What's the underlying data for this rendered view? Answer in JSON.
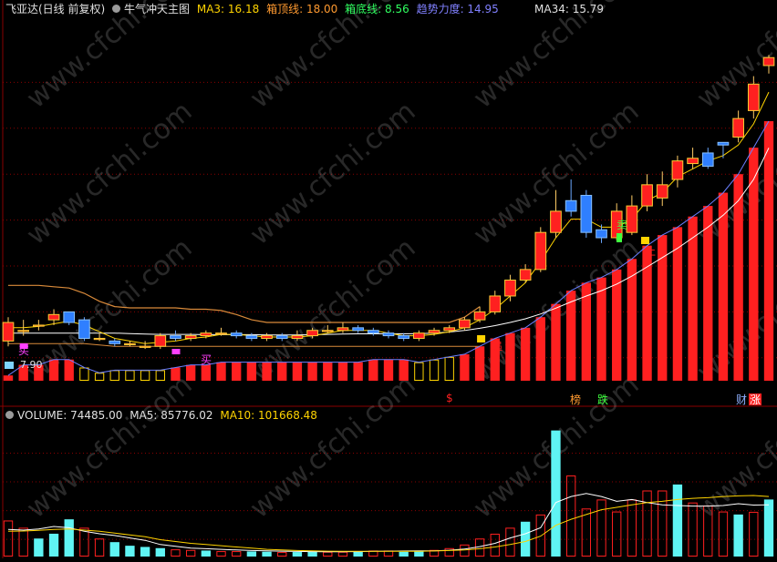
{
  "header": {
    "stock_name": "飞亚达(日线 前复权)",
    "indicator_name": "牛气冲天主图",
    "ma3_label": "MA3: 16.18",
    "box_top_label": "箱顶线: 18.00",
    "box_bottom_label": "箱底线: 8.56",
    "trend_label": "趋势力度: 14.95",
    "ma34_label": "MA34: 15.79"
  },
  "volume_header": {
    "title": "VOLUME: 74485.00",
    "ma5_label": "MA5: 85776.02",
    "ma10_label": "MA10: 101668.48"
  },
  "price_axis_label": "7.90",
  "watermark": "www.cfchi.com",
  "signals": {
    "buy": "买",
    "chase": "追",
    "sell": "卖",
    "stop": "止",
    "dollar": "$",
    "bang": "榜",
    "die": "跌",
    "cai": "财",
    "zhang": "涨"
  },
  "colors": {
    "up": "#ff2020",
    "down": "#2f7fff",
    "ma_yellow": "#ffd400",
    "ma_white": "#ffffff",
    "band": "#d98a3a",
    "cyan": "#5ff4f4",
    "grid": "#8a0000",
    "magenta": "#ff40ff"
  },
  "chart_data": {
    "type": "candlestick",
    "x": [
      1,
      2,
      3,
      4,
      5,
      6,
      7,
      8,
      9,
      10,
      11,
      12,
      13,
      14,
      15,
      16,
      17,
      18,
      19,
      20,
      21,
      22,
      23,
      24,
      25,
      26,
      27,
      28,
      29,
      30,
      31,
      32,
      33,
      34,
      35,
      36,
      37,
      38,
      39,
      40,
      41,
      42,
      43,
      44,
      45,
      46,
      47,
      48,
      49,
      50,
      51
    ],
    "open": [
      8.5,
      8.9,
      9.1,
      9.3,
      9.6,
      9.3,
      8.6,
      8.5,
      8.4,
      8.3,
      8.3,
      8.7,
      8.6,
      8.7,
      8.8,
      8.8,
      8.7,
      8.6,
      8.7,
      8.6,
      8.7,
      8.9,
      8.9,
      9.0,
      8.9,
      8.8,
      8.7,
      8.6,
      8.8,
      8.9,
      9.0,
      9.3,
      9.6,
      10.2,
      10.8,
      11.2,
      12.6,
      13.8,
      14.0,
      12.7,
      12.4,
      12.6,
      13.6,
      13.9,
      14.6,
      15.2,
      15.6,
      16.0,
      16.2,
      17.2,
      18.9
    ],
    "close": [
      9.2,
      8.9,
      9.1,
      9.5,
      9.2,
      8.6,
      8.6,
      8.4,
      8.4,
      8.3,
      8.7,
      8.6,
      8.7,
      8.8,
      8.8,
      8.7,
      8.6,
      8.7,
      8.6,
      8.7,
      8.9,
      8.9,
      9.0,
      8.9,
      8.8,
      8.7,
      8.6,
      8.8,
      8.9,
      9.0,
      9.3,
      9.6,
      10.2,
      10.8,
      11.2,
      12.6,
      13.4,
      13.4,
      12.6,
      12.4,
      13.4,
      13.6,
      14.4,
      14.4,
      15.3,
      15.4,
      15.1,
      15.9,
      16.9,
      18.2,
      19.2
    ],
    "high": [
      9.4,
      9.3,
      9.3,
      9.7,
      9.6,
      9.4,
      8.8,
      8.6,
      8.5,
      8.5,
      8.8,
      8.9,
      8.8,
      8.9,
      9.0,
      8.9,
      8.8,
      8.8,
      8.8,
      8.9,
      9.0,
      9.1,
      9.2,
      9.1,
      9.0,
      8.9,
      8.8,
      8.9,
      9.0,
      9.1,
      9.4,
      9.8,
      10.4,
      11.0,
      11.4,
      12.8,
      14.2,
      14.6,
      14.2,
      12.9,
      13.7,
      14.0,
      14.8,
      14.9,
      15.5,
      15.8,
      15.8,
      16.0,
      17.2,
      18.5,
      19.3
    ],
    "low": [
      8.3,
      8.7,
      8.9,
      9.1,
      9.1,
      8.5,
      8.5,
      8.3,
      8.3,
      8.2,
      8.2,
      8.5,
      8.5,
      8.6,
      8.7,
      8.6,
      8.5,
      8.5,
      8.5,
      8.5,
      8.6,
      8.8,
      8.8,
      8.8,
      8.7,
      8.6,
      8.5,
      8.5,
      8.7,
      8.8,
      8.9,
      9.2,
      9.5,
      10.0,
      10.7,
      11.1,
      12.4,
      13.2,
      12.4,
      12.2,
      12.3,
      12.5,
      13.4,
      13.6,
      14.3,
      15.0,
      15.0,
      15.4,
      16.0,
      16.9,
      18.6
    ],
    "ma3": [
      9.0,
      9.0,
      9.05,
      9.15,
      9.25,
      9.1,
      8.85,
      8.6,
      8.5,
      8.4,
      8.45,
      8.5,
      8.6,
      8.65,
      8.75,
      8.75,
      8.7,
      8.65,
      8.65,
      8.65,
      8.7,
      8.8,
      8.9,
      8.9,
      8.9,
      8.8,
      8.7,
      8.7,
      8.75,
      8.85,
      9.0,
      9.3,
      9.7,
      10.2,
      10.7,
      11.5,
      12.4,
      13.1,
      13.1,
      12.8,
      12.8,
      13.1,
      13.8,
      14.1,
      14.7,
      15.0,
      15.3,
      15.5,
      15.9,
      16.7,
      17.9
    ],
    "ma34": [
      8.8,
      8.8,
      8.8,
      8.8,
      8.8,
      8.8,
      8.8,
      8.8,
      8.78,
      8.76,
      8.75,
      8.75,
      8.75,
      8.74,
      8.74,
      8.74,
      8.74,
      8.73,
      8.73,
      8.73,
      8.74,
      8.75,
      8.76,
      8.77,
      8.77,
      8.77,
      8.77,
      8.78,
      8.8,
      8.84,
      8.9,
      8.98,
      9.08,
      9.2,
      9.34,
      9.52,
      9.74,
      9.98,
      10.2,
      10.4,
      10.65,
      10.95,
      11.3,
      11.65,
      12.0,
      12.4,
      12.8,
      13.25,
      13.8,
      14.6,
      15.79
    ],
    "box_top": [
      10.6,
      10.6,
      10.6,
      10.55,
      10.5,
      10.3,
      10.0,
      9.8,
      9.75,
      9.75,
      9.75,
      9.75,
      9.7,
      9.7,
      9.65,
      9.5,
      9.3,
      9.2,
      9.2,
      9.2,
      9.2,
      9.2,
      9.2,
      9.2,
      9.2,
      9.2,
      9.2,
      9.2,
      9.2,
      9.2,
      9.4,
      9.8,
      null,
      null,
      null,
      null,
      null,
      null,
      null,
      null,
      null,
      null,
      null,
      null,
      null,
      null,
      null,
      null,
      null,
      null,
      null
    ],
    "box_bottom": [
      8.4,
      8.4,
      8.4,
      8.4,
      8.4,
      8.4,
      8.35,
      8.3,
      8.3,
      8.3,
      8.3,
      8.3,
      8.3,
      8.3,
      8.3,
      8.3,
      8.3,
      8.3,
      8.3,
      8.3,
      8.3,
      8.3,
      8.3,
      8.3,
      8.3,
      8.3,
      8.3,
      8.3,
      8.3,
      8.3,
      8.3,
      8.3,
      null,
      null,
      null,
      null,
      null,
      null,
      null,
      null,
      null,
      null,
      null,
      null,
      null,
      null,
      null,
      null,
      null,
      null,
      null
    ],
    "trend_bars": [
      7.2,
      7.6,
      7.6,
      7.8,
      7.8,
      7.5,
      7.3,
      7.4,
      7.4,
      7.4,
      7.4,
      7.5,
      7.6,
      7.6,
      7.7,
      7.7,
      7.7,
      7.7,
      7.7,
      7.7,
      7.7,
      7.7,
      7.7,
      7.7,
      7.8,
      7.8,
      7.8,
      7.7,
      7.8,
      7.9,
      8.0,
      8.3,
      8.6,
      8.8,
      9.0,
      9.4,
      9.9,
      10.4,
      10.7,
      10.9,
      11.2,
      11.6,
      12.1,
      12.5,
      12.8,
      13.2,
      13.6,
      14.1,
      14.8,
      15.8,
      16.8
    ],
    "trend_colors": [
      "r",
      "r",
      "r",
      "r",
      "r",
      "y",
      "y",
      "y",
      "y",
      "y",
      "y",
      "r",
      "r",
      "r",
      "r",
      "r",
      "r",
      "r",
      "r",
      "r",
      "r",
      "r",
      "r",
      "r",
      "r",
      "r",
      "r",
      "y",
      "y",
      "y",
      "r",
      "r",
      "r",
      "r",
      "r",
      "r",
      "r",
      "r",
      "r",
      "r",
      "r",
      "r",
      "r",
      "r",
      "r",
      "r",
      "r",
      "r",
      "r",
      "r",
      "r"
    ],
    "volume": [
      60000,
      48000,
      30000,
      38000,
      62000,
      48000,
      30000,
      24000,
      18000,
      16000,
      14000,
      12000,
      11000,
      10000,
      9000,
      9000,
      8500,
      8000,
      7500,
      7500,
      8000,
      8000,
      8000,
      9000,
      10000,
      10000,
      8000,
      9000,
      11000,
      14000,
      20000,
      30000,
      38000,
      48000,
      58000,
      70000,
      210000,
      135000,
      80000,
      95000,
      75000,
      95000,
      110000,
      110000,
      120000,
      90000,
      85000,
      75000,
      70000,
      74485,
      95000
    ],
    "vol_colors": [
      "r",
      "r",
      "c",
      "c",
      "c",
      "r",
      "r",
      "c",
      "c",
      "c",
      "c",
      "r",
      "r",
      "c",
      "r",
      "r",
      "c",
      "c",
      "r",
      "c",
      "c",
      "r",
      "r",
      "c",
      "r",
      "r",
      "c",
      "c",
      "r",
      "r",
      "r",
      "r",
      "r",
      "r",
      "c",
      "r",
      "c",
      "r",
      "r",
      "r",
      "r",
      "r",
      "r",
      "r",
      "c",
      "r",
      "r",
      "r",
      "c",
      "r",
      "c"
    ],
    "vol_ma5": [
      45000,
      44000,
      46000,
      50000,
      48000,
      42000,
      38000,
      35000,
      31000,
      27000,
      20000,
      17000,
      14000,
      13000,
      12000,
      11000,
      10000,
      9500,
      9000,
      8500,
      8200,
      8000,
      8000,
      8200,
      8600,
      9000,
      9200,
      9500,
      9500,
      10500,
      12500,
      16500,
      22000,
      31000,
      38000,
      48000,
      90000,
      100000,
      105000,
      100000,
      92000,
      95000,
      90000,
      86000,
      85000,
      84000,
      84000,
      85000,
      88000,
      85776,
      86000
    ],
    "vol_ma10": [
      42000,
      42500,
      43500,
      45000,
      46000,
      44000,
      42000,
      39000,
      36000,
      33000,
      28000,
      25000,
      22000,
      20000,
      18000,
      16000,
      14000,
      12000,
      11000,
      10000,
      9500,
      9000,
      8800,
      8700,
      8700,
      8700,
      8700,
      8800,
      9200,
      10000,
      11000,
      13000,
      16000,
      20000,
      25000,
      34000,
      52000,
      62000,
      70000,
      78000,
      82000,
      86000,
      90000,
      92000,
      95000,
      97000,
      98000,
      100000,
      101000,
      101668,
      100000
    ],
    "price_range": [
      7.0,
      20.0
    ],
    "volume_range": [
      0,
      220000
    ]
  }
}
